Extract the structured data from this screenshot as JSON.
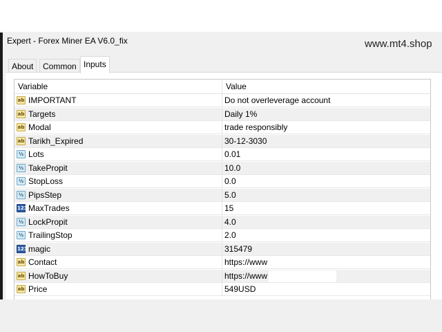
{
  "window": {
    "title": "Expert - Forex Miner EA V6.0_fix"
  },
  "watermark": "www.mt4.shop",
  "tabs": [
    {
      "label": "About",
      "active": false
    },
    {
      "label": "Common",
      "active": false
    },
    {
      "label": "Inputs",
      "active": true
    }
  ],
  "grid": {
    "headers": {
      "variable": "Variable",
      "value": "Value"
    },
    "rows": [
      {
        "type": "ab",
        "icon_text": "ab",
        "variable": "IMPORTANT",
        "value": "Do not overleverage account"
      },
      {
        "type": "ab",
        "icon_text": "ab",
        "variable": "Targets",
        "value": "Daily 1%"
      },
      {
        "type": "ab",
        "icon_text": "ab",
        "variable": "Modal",
        "value": "trade responsibly"
      },
      {
        "type": "ab",
        "icon_text": "ab",
        "variable": "Tarikh_Expired",
        "value": "30-12-3030"
      },
      {
        "type": "dbl",
        "icon_text": "½",
        "variable": "Lots",
        "value": "0.01"
      },
      {
        "type": "dbl",
        "icon_text": "½",
        "variable": "TakePropit",
        "value": "10.0"
      },
      {
        "type": "dbl",
        "icon_text": "½",
        "variable": "StopLoss",
        "value": "0.0"
      },
      {
        "type": "dbl",
        "icon_text": "½",
        "variable": "PipsStep",
        "value": "5.0"
      },
      {
        "type": "int",
        "icon_text": "123",
        "variable": "MaxTrades",
        "value": "15"
      },
      {
        "type": "dbl",
        "icon_text": "½",
        "variable": "LockPropit",
        "value": "4.0"
      },
      {
        "type": "dbl",
        "icon_text": "½",
        "variable": "TrailingStop",
        "value": "2.0"
      },
      {
        "type": "int",
        "icon_text": "123",
        "variable": "magic",
        "value": "315479"
      },
      {
        "type": "ab",
        "icon_text": "ab",
        "variable": "Contact",
        "value": "https://www"
      },
      {
        "type": "ab",
        "icon_text": "ab",
        "variable": "HowToBuy",
        "value": "https://www"
      },
      {
        "type": "ab",
        "icon_text": "ab",
        "variable": "Price",
        "value": "549USD"
      }
    ]
  },
  "colors": {
    "panel_bg": "#f0f0f0",
    "row_alt": "#f0f0f0",
    "string_icon": "#f5e7a6",
    "double_icon": "#d6ecf7",
    "int_icon": "#2f5fa8"
  }
}
